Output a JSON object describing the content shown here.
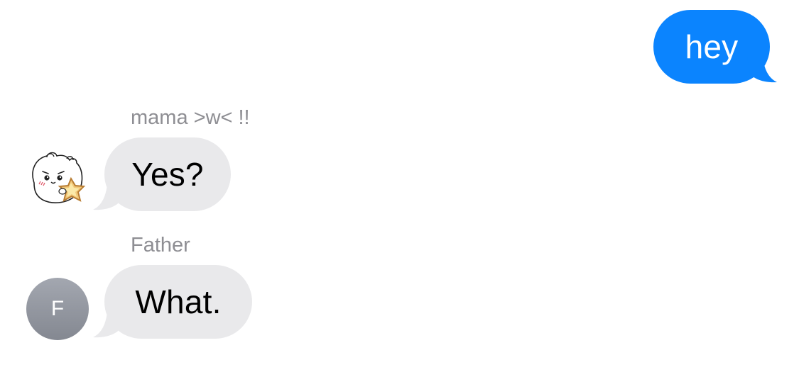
{
  "conversation": {
    "messages": [
      {
        "direction": "outgoing",
        "text": "hey"
      },
      {
        "direction": "incoming",
        "sender": "mama >w< !!",
        "text": "Yes?",
        "avatar": "hamster-sticker-icon"
      },
      {
        "direction": "incoming",
        "sender": "Father",
        "text": "What.",
        "avatar_initial": "F"
      }
    ]
  },
  "colors": {
    "outgoing_bubble": "#0b84fe",
    "incoming_bubble": "#e9e9eb",
    "sender_label": "#8e8e93",
    "avatar_gray": "#8e9299"
  }
}
